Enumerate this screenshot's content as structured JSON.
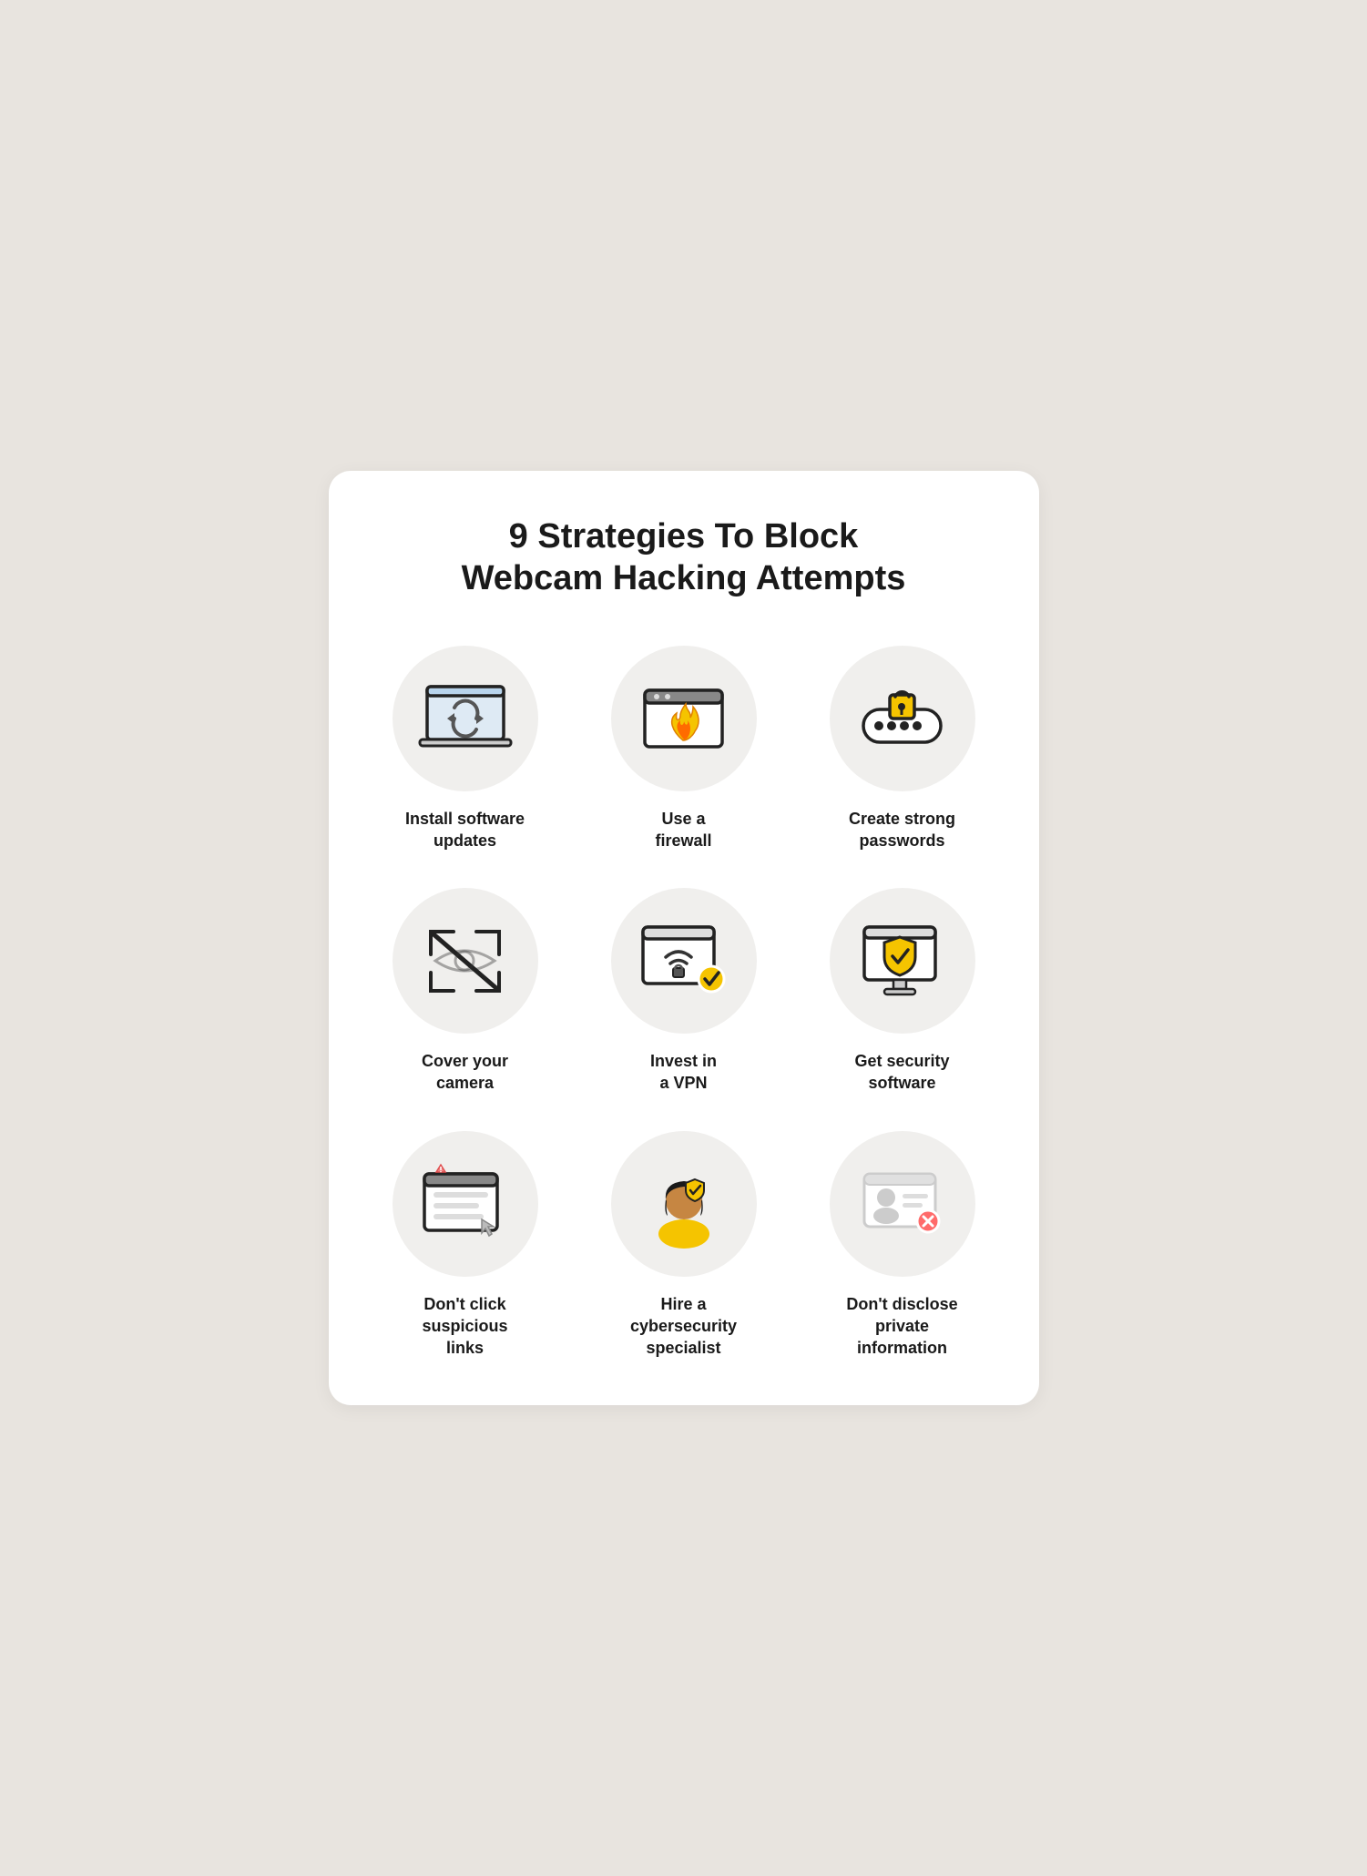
{
  "page": {
    "title_line1": "9 Strategies To Block",
    "title_line2": "Webcam Hacking Attempts"
  },
  "items": [
    {
      "id": "install-updates",
      "label": "Install software\nupdates"
    },
    {
      "id": "use-firewall",
      "label": "Use a\nfirewall"
    },
    {
      "id": "strong-passwords",
      "label": "Create strong\npasswords"
    },
    {
      "id": "cover-camera",
      "label": "Cover your\ncamera"
    },
    {
      "id": "invest-vpn",
      "label": "Invest in\na VPN"
    },
    {
      "id": "security-software",
      "label": "Get security\nsoftware"
    },
    {
      "id": "suspicious-links",
      "label": "Don't click\nsuspicious\nlinks"
    },
    {
      "id": "cybersecurity-specialist",
      "label": "Hire a\ncybersecurity\nspecialist"
    },
    {
      "id": "private-info",
      "label": "Don't disclose\nprivate\ninformation"
    }
  ]
}
